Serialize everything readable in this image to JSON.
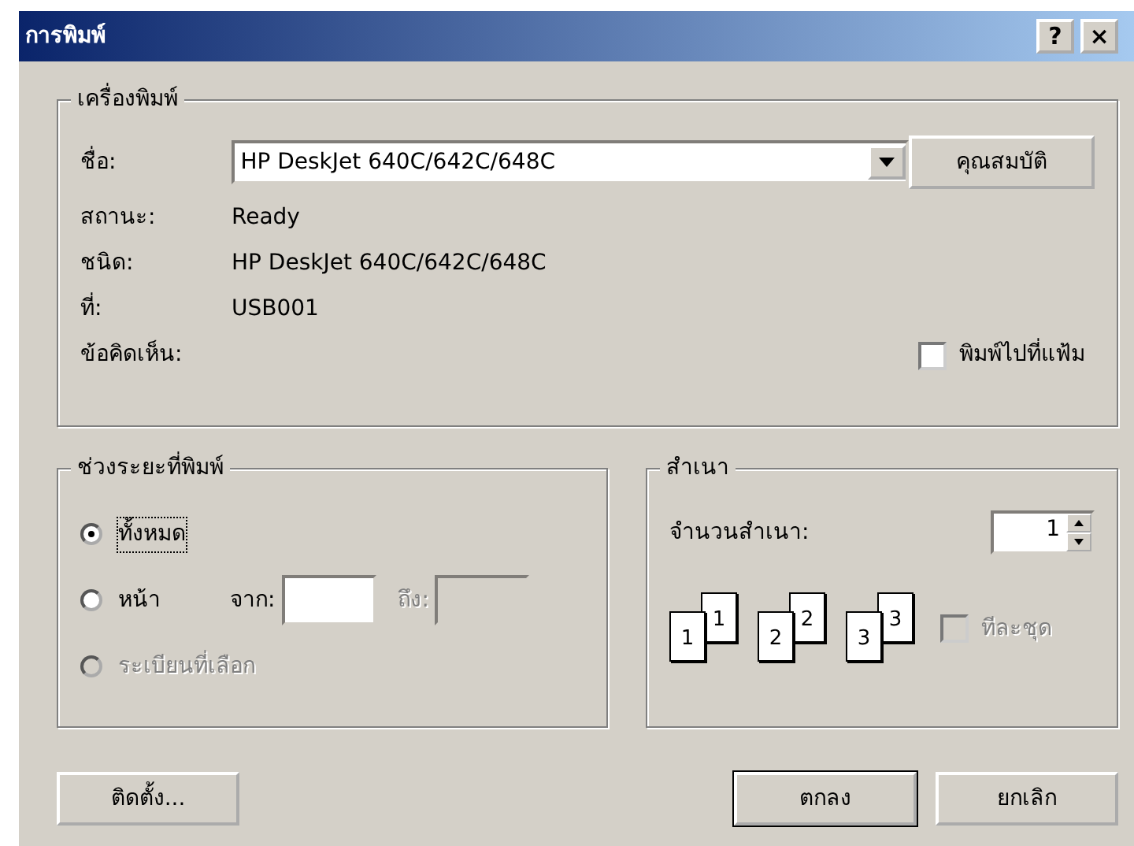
{
  "window": {
    "title": "การพิมพ์",
    "help_button": "?",
    "close_button": "×"
  },
  "printer": {
    "legend": "เครื่องพิมพ์",
    "name_label": "ชื่อ:",
    "name_value": "HP DeskJet 640C/642C/648C",
    "properties_button": "คุณสมบัติ",
    "info": [
      {
        "label": "สถานะ:",
        "value": "Ready"
      },
      {
        "label": "ชนิด:",
        "value": "HP DeskJet 640C/642C/648C"
      },
      {
        "label": "ที่:",
        "value": "USB001"
      },
      {
        "label": "ข้อคิดเห็น:"
      }
    ],
    "print_to_file": {
      "label": "พิมพ์ไปที่แฟ้ม",
      "checked": false
    }
  },
  "range": {
    "legend": "ช่วงระยะที่พิมพ์",
    "options": [
      {
        "label": "ทั้งหมด",
        "selected": true,
        "disabled": false,
        "focused": true
      },
      {
        "label": "หน้า",
        "selected": false,
        "disabled": false,
        "focused": false
      },
      {
        "label": "ระเบียนที่เลือก",
        "selected": false,
        "disabled": true,
        "focused": false
      }
    ],
    "from": {
      "label": "จาก:",
      "disabled": false
    },
    "to": {
      "label": "ถึง:",
      "disabled": true
    }
  },
  "copies": {
    "legend": "สำเนา",
    "count_label": "จำนวนสำเนา:",
    "count": "1",
    "collate_pages": [
      {
        "back": "1",
        "front": "1"
      },
      {
        "back": "2",
        "front": "2"
      },
      {
        "back": "3",
        "front": "3"
      }
    ],
    "collate": {
      "label": "ทีละชุด",
      "checked": false,
      "disabled": true
    }
  },
  "buttons": [
    {
      "label": "ติดตั้ง...",
      "default": false
    },
    {
      "label": "ตกลง",
      "default": true
    },
    {
      "label": "ยกเลิก",
      "default": false
    }
  ]
}
